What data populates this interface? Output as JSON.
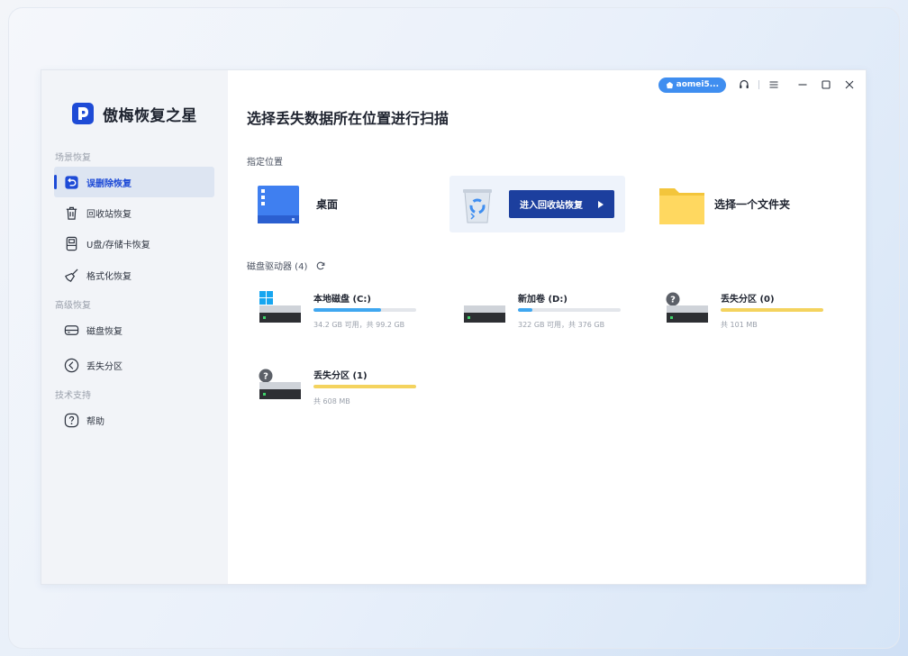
{
  "app": {
    "name": "傲梅恢复之星"
  },
  "colors": {
    "accent": "#1e4bd6",
    "button": "#1c3f9e",
    "bar_used_blue": "#3fa7f0",
    "bar_yellow": "#f4d35e"
  },
  "sidebar": {
    "sections": [
      {
        "label": "场景恢复"
      },
      {
        "label": "高级恢复"
      },
      {
        "label": "技术支持"
      }
    ],
    "items": [
      {
        "label": "误删除恢复",
        "icon": "undo-icon",
        "active": true
      },
      {
        "label": "回收站恢复",
        "icon": "trash-icon",
        "active": false
      },
      {
        "label": "U盘/存储卡恢复",
        "icon": "usb-drive-icon",
        "active": false
      },
      {
        "label": "格式化恢复",
        "icon": "broom-icon",
        "active": false
      },
      {
        "label": "磁盘恢复",
        "icon": "disk-icon",
        "active": false
      },
      {
        "label": "丢失分区",
        "icon": "lost-partition-icon",
        "active": false
      },
      {
        "label": "帮助",
        "icon": "help-icon",
        "active": false
      }
    ]
  },
  "topbar": {
    "user": "aomei5...",
    "icons": [
      "headset-icon",
      "menu-icon",
      "minimize-icon",
      "maximize-icon",
      "close-icon"
    ]
  },
  "main": {
    "title": "选择丢失数据所在位置进行扫描",
    "locations_label": "指定位置",
    "locations": [
      {
        "label": "桌面",
        "icon": "desktop-icon"
      },
      {
        "button": "进入回收站恢复",
        "icon": "recycle-bin-icon"
      },
      {
        "label": "选择一个文件夹",
        "icon": "folder-icon"
      }
    ],
    "drives_label": "磁盘驱动器 (4)",
    "drives": [
      {
        "name": "本地磁盘 (C:)",
        "info": "34.2 GB 可用，共 99.2 GB",
        "used_fraction": 0.655,
        "bar": "blue",
        "icon": "windows-drive-icon"
      },
      {
        "name": "新加卷 (D:)",
        "info": "322 GB 可用，共 376 GB",
        "used_fraction": 0.144,
        "bar": "blue",
        "icon": "drive-icon"
      },
      {
        "name": "丢失分区 (0)",
        "info": "共 101 MB",
        "used_fraction": 1.0,
        "bar": "yellow",
        "icon": "unknown-drive-icon"
      },
      {
        "name": "丢失分区 (1)",
        "info": "共 608 MB",
        "used_fraction": 1.0,
        "bar": "yellow",
        "icon": "unknown-drive-icon"
      }
    ]
  }
}
